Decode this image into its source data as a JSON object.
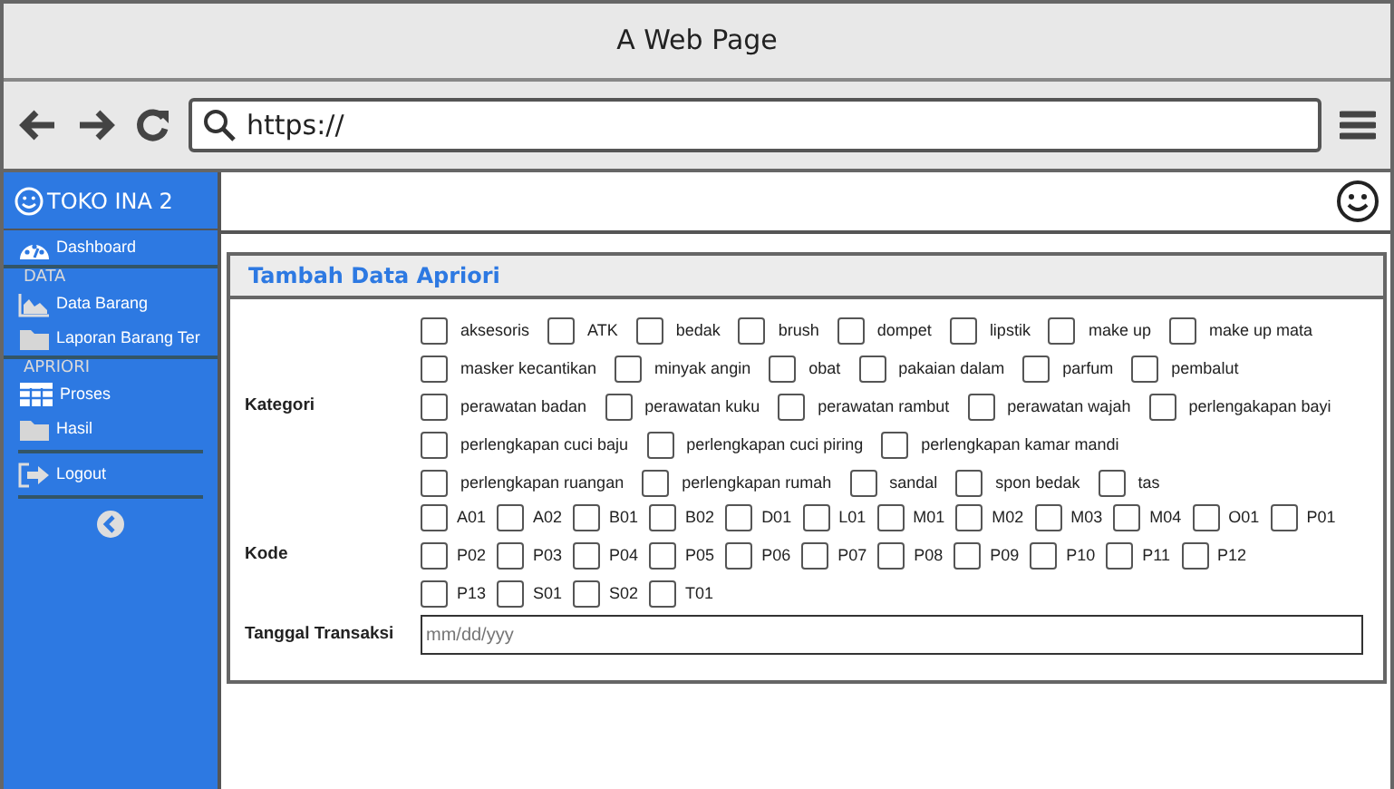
{
  "window": {
    "title": "A Web Page",
    "address": "https://"
  },
  "sidebar": {
    "brand": "TOKO INA 2",
    "items": [
      {
        "kind": "item",
        "label": "Dashboard"
      },
      {
        "kind": "section",
        "label": "DATA"
      },
      {
        "kind": "item",
        "label": "Data Barang"
      },
      {
        "kind": "item",
        "label": "Laporan Barang Ter"
      },
      {
        "kind": "section",
        "label": "APRIORI"
      },
      {
        "kind": "item",
        "label": "Proses"
      },
      {
        "kind": "item",
        "label": "Hasil"
      },
      {
        "kind": "item",
        "label": "Logout"
      }
    ]
  },
  "panel": {
    "title": "Tambah Data Apriori",
    "groups": [
      {
        "label": "Kategori",
        "lines": [
          {
            "options": [
              {
                "label": "aksesoris",
                "checked": false
              },
              {
                "label": "ATK",
                "checked": false
              },
              {
                "label": "bedak",
                "checked": false
              },
              {
                "label": "brush",
                "checked": false
              },
              {
                "label": "dompet",
                "checked": false
              },
              {
                "label": "lipstik",
                "checked": false
              },
              {
                "label": "make up",
                "checked": false
              },
              {
                "label": "make up mata",
                "checked": false
              }
            ]
          },
          {
            "options": [
              {
                "label": "masker kecantikan",
                "checked": false
              },
              {
                "label": "minyak angin",
                "checked": false
              },
              {
                "label": "obat",
                "checked": false
              },
              {
                "label": "pakaian dalam",
                "checked": false
              },
              {
                "label": "parfum",
                "checked": false
              },
              {
                "label": "pembalut",
                "checked": false
              }
            ]
          },
          {
            "options": [
              {
                "label": "perawatan badan",
                "checked": false
              },
              {
                "label": "perawatan kuku",
                "checked": false
              },
              {
                "label": "perawatan rambut",
                "checked": false
              },
              {
                "label": "perawatan wajah",
                "checked": false
              },
              {
                "label": "perlengakapan bayi",
                "checked": false
              }
            ]
          },
          {
            "options": [
              {
                "label": "perlengkapan cuci baju",
                "checked": false
              },
              {
                "label": "perlengkapan cuci piring",
                "checked": false
              },
              {
                "label": "perlengkapan kamar mandi",
                "checked": false
              }
            ]
          },
          {
            "options": [
              {
                "label": "perlengkapan ruangan",
                "checked": false
              },
              {
                "label": "perlengkapan rumah",
                "checked": false
              },
              {
                "label": "sandal",
                "checked": false
              },
              {
                "label": "spon bedak",
                "checked": false
              },
              {
                "label": "tas",
                "checked": false
              }
            ]
          }
        ]
      },
      {
        "label": "Kode",
        "lines": [
          {
            "options": [
              {
                "label": "A01",
                "checked": false
              },
              {
                "label": "A02",
                "checked": false
              },
              {
                "label": "B01",
                "checked": false
              },
              {
                "label": "B02",
                "checked": false
              },
              {
                "label": "D01",
                "checked": false
              },
              {
                "label": "L01",
                "checked": false
              },
              {
                "label": "M01",
                "checked": false
              },
              {
                "label": "M02",
                "checked": false
              },
              {
                "label": "M03",
                "checked": false
              },
              {
                "label": "M04",
                "checked": false
              },
              {
                "label": "O01",
                "checked": false
              },
              {
                "label": "P01",
                "checked": false
              }
            ]
          },
          {
            "options": [
              {
                "label": "P02",
                "checked": false
              },
              {
                "label": "P03",
                "checked": false
              },
              {
                "label": "P04",
                "checked": false
              },
              {
                "label": "P05",
                "checked": false
              },
              {
                "label": "P06",
                "checked": false
              },
              {
                "label": "P07",
                "checked": false
              },
              {
                "label": "P08",
                "checked": false
              },
              {
                "label": "P09",
                "checked": false
              },
              {
                "label": "P10",
                "checked": false
              },
              {
                "label": "P11",
                "checked": false
              },
              {
                "label": "P12",
                "checked": false
              }
            ]
          },
          {
            "options": [
              {
                "label": "P13",
                "checked": false
              },
              {
                "label": "S01",
                "checked": false
              },
              {
                "label": "S02",
                "checked": false
              },
              {
                "label": "T01",
                "checked": false
              }
            ]
          }
        ]
      }
    ],
    "date": {
      "label": "Tanggal Transaksi",
      "placeholder": "mm/dd/yyy"
    }
  }
}
